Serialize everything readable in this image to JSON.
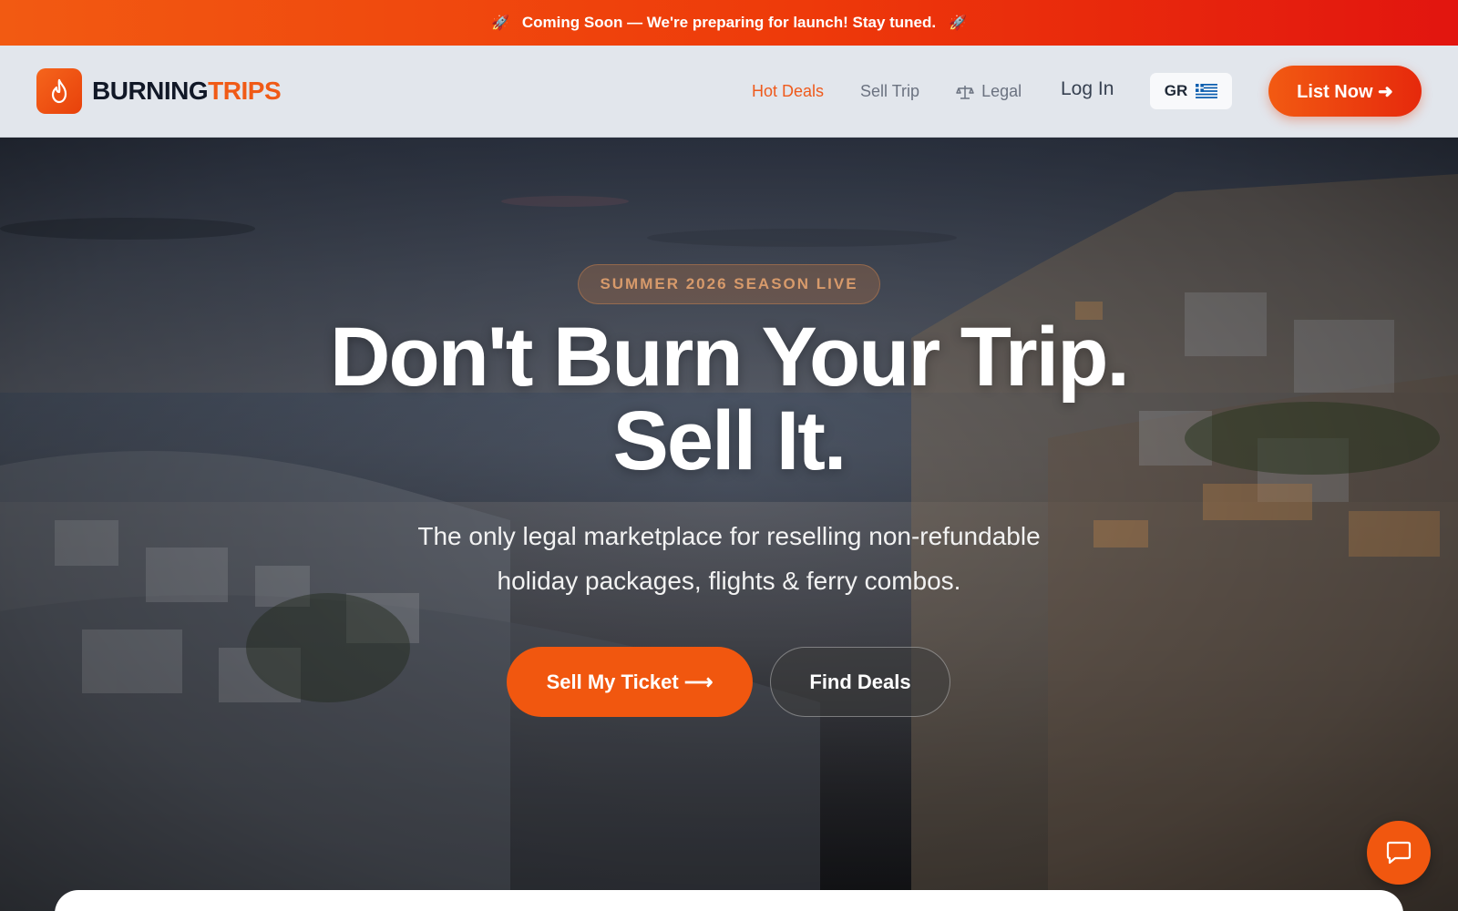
{
  "banner": {
    "text": "Coming Soon — We're preparing for launch! Stay tuned.",
    "icon_left": "rocket-icon",
    "icon_right": "rocket-icon"
  },
  "brand": {
    "name_part1": "BURNING",
    "name_part2": "TRIPS",
    "logo_icon": "flame-icon",
    "primary_color": "#f1570f",
    "dark_color": "#111827"
  },
  "nav": {
    "links": [
      {
        "label": "Hot Deals",
        "active": true
      },
      {
        "label": "Sell Trip",
        "active": false
      },
      {
        "label": "Legal",
        "active": false,
        "icon": "scale-icon"
      }
    ],
    "login_label": "Log In",
    "language": {
      "code": "GR",
      "flag": "greece-flag-icon"
    },
    "cta_label": "List Now ➜"
  },
  "hero": {
    "pill": "SUMMER 2026 SEASON LIVE",
    "title_line1": "Don't Burn Your Trip.",
    "title_line2": "Sell It.",
    "subtitle_line1": "The only legal marketplace for reselling non-refundable",
    "subtitle_line2": "holiday packages, flights & ferry combos.",
    "primary_button": "Sell My Ticket ⟶",
    "secondary_button": "Find Deals"
  },
  "chat": {
    "icon": "chat-bubble-icon"
  }
}
